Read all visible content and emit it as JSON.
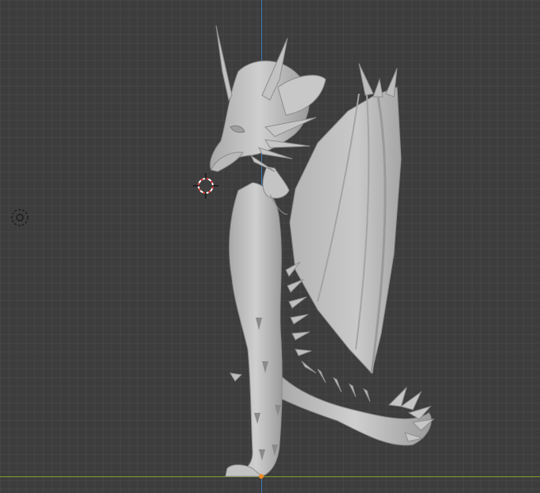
{
  "viewport": {
    "background_color": "#3d3d3d",
    "grid_color": "#474747",
    "axis_z_color": "#3d77b4",
    "axis_y_color": "#7fa02b",
    "origin_color": "#f08a24"
  },
  "scene": {
    "object": "dragon-sculpt",
    "material_color": "#c3c3c3",
    "shadow_color": "#8e8e8e"
  },
  "overlays": {
    "camera_icon": "camera-view-icon",
    "cursor_icon": "3d-cursor-icon"
  }
}
